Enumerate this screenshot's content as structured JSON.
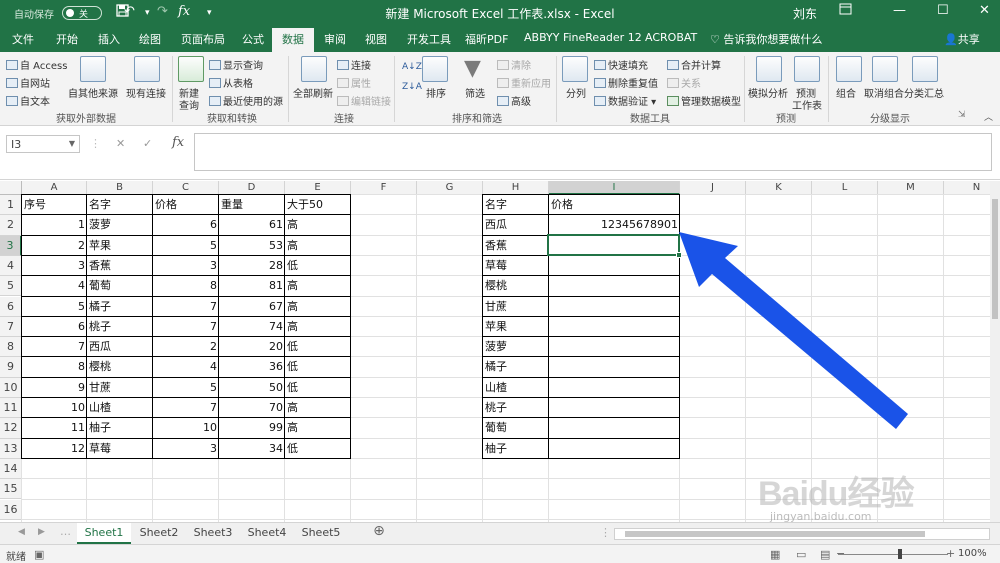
{
  "titlebar": {
    "autosave": "自动保存",
    "autosave_state": "关",
    "title": "新建 Microsoft Excel 工作表.xlsx  -  Excel",
    "user": "刘东"
  },
  "tabs": [
    "文件",
    "开始",
    "插入",
    "绘图",
    "页面布局",
    "公式",
    "数据",
    "审阅",
    "视图",
    "开发工具",
    "福昕PDF",
    "ABBYY FineReader 12",
    "ACROBAT"
  ],
  "active_tab": "数据",
  "tell_me": "告诉我你想要做什么",
  "share": "共享",
  "ribbon": {
    "ext_access": "自 Access",
    "ext_web": "自网站",
    "ext_text": "自文本",
    "ext_other": "自其他来源",
    "ext_conn": "现有连接",
    "group_ext": "获取外部数据",
    "new_query_1": "新建",
    "new_query_2": "查询",
    "show_query": "显示查询",
    "from_table": "从表格",
    "recent_src": "最近使用的源",
    "group_transform": "获取和转换",
    "refresh_all": "全部刷新",
    "conn": "连接",
    "props": "属性",
    "edit_links": "编辑链接",
    "group_conn": "连接",
    "sort": "排序",
    "filter": "筛选",
    "clear": "清除",
    "reapply": "重新应用",
    "advanced": "高级",
    "group_sort": "排序和筛选",
    "split": "分列",
    "flash_fill": "快速填充",
    "remove_dup": "删除重复值",
    "validation": "数据验证",
    "consolidate": "合并计算",
    "relations": "关系",
    "manage_model": "管理数据模型",
    "group_tools": "数据工具",
    "whatif": "模拟分析",
    "forecast_1": "预测",
    "forecast_2": "工作表",
    "group_forecast": "预测",
    "group_btn": "组合",
    "ungroup_btn": "取消组合",
    "subtotal": "分类汇总",
    "group_outline": "分级显示"
  },
  "formula_bar": {
    "name_box": "I3",
    "formula": ""
  },
  "columns": [
    "A",
    "B",
    "C",
    "D",
    "E",
    "F",
    "G",
    "H",
    "I",
    "J",
    "K",
    "L",
    "M",
    "N"
  ],
  "rows": [
    "1",
    "2",
    "3",
    "4",
    "5",
    "6",
    "7",
    "8",
    "9",
    "10",
    "11",
    "12",
    "13",
    "14",
    "15",
    "16"
  ],
  "table1": {
    "headers": [
      "序号",
      "名字",
      "价格",
      "重量",
      "大于50"
    ],
    "rows": [
      [
        "1",
        "菠萝",
        "6",
        "61",
        "高"
      ],
      [
        "2",
        "苹果",
        "5",
        "53",
        "高"
      ],
      [
        "3",
        "香蕉",
        "3",
        "28",
        "低"
      ],
      [
        "4",
        "葡萄",
        "8",
        "81",
        "高"
      ],
      [
        "5",
        "橘子",
        "7",
        "67",
        "高"
      ],
      [
        "6",
        "桃子",
        "7",
        "74",
        "高"
      ],
      [
        "7",
        "西瓜",
        "2",
        "20",
        "低"
      ],
      [
        "8",
        "樱桃",
        "4",
        "36",
        "低"
      ],
      [
        "9",
        "甘蔗",
        "5",
        "50",
        "低"
      ],
      [
        "10",
        "山楂",
        "7",
        "70",
        "高"
      ],
      [
        "11",
        "柚子",
        "10",
        "99",
        "高"
      ],
      [
        "12",
        "草莓",
        "3",
        "34",
        "低"
      ]
    ]
  },
  "table2": {
    "headers": [
      "名字",
      "价格"
    ],
    "names": [
      "西瓜",
      "香蕉",
      "草莓",
      "樱桃",
      "甘蔗",
      "苹果",
      "菠萝",
      "橘子",
      "山楂",
      "桃子",
      "葡萄",
      "柚子"
    ],
    "prices": [
      "12345678901",
      "",
      "",
      "",
      "",
      "",
      "",
      "",
      "",
      "",
      "",
      ""
    ]
  },
  "sheets": [
    "Sheet1",
    "Sheet2",
    "Sheet3",
    "Sheet4",
    "Sheet5"
  ],
  "active_sheet": "Sheet1",
  "status": {
    "ready": "就绪",
    "zoom": "100%"
  },
  "watermark": {
    "line1": "Baidu经验",
    "line2": "jingyan.baidu.com"
  },
  "colors": {
    "excel_green": "#217346",
    "arrow_blue": "#1a53e8"
  }
}
